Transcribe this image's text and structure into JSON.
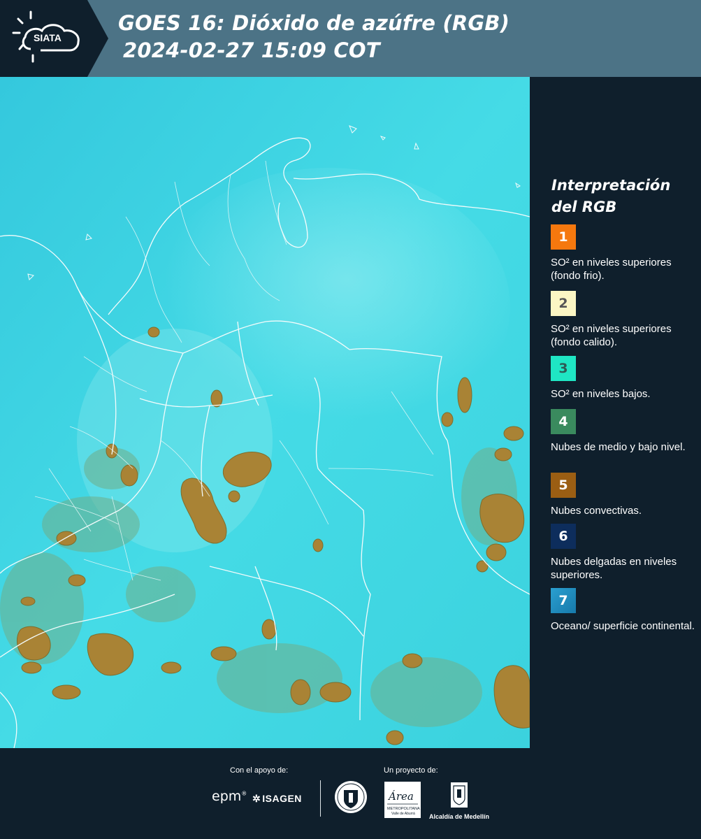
{
  "header": {
    "logo_text": "SIATA",
    "title_line1": "GOES 16: Dióxido de azúfre (RGB)",
    "title_line2": "2024-02-27 15:09 COT"
  },
  "legend": {
    "title": "Interpretación del RGB",
    "items": [
      {
        "number": "1",
        "color": "#f5780e",
        "text_color": "#ffffff",
        "label": "SO² en niveles superiores (fondo frio)."
      },
      {
        "number": "2",
        "color": "#fbf6c4",
        "text_color": "#555555",
        "label": "SO² en niveles superiores (fondo calido)."
      },
      {
        "number": "3",
        "color": "#1fe6c4",
        "text_color": "#2e5a55",
        "label": "SO² en niveles bajos."
      },
      {
        "number": "4",
        "color": "#3a8a5e",
        "text_color": "#ffffff",
        "label": "Nubes de medio y bajo nivel."
      },
      {
        "number": "5",
        "color": "#9b5e13",
        "text_color": "#ffffff",
        "label": "Nubes convectivas."
      },
      {
        "number": "6",
        "color": "#0d2d5c",
        "text_color": "#ffffff",
        "label": "Nubes delgadas en niveles superiores."
      },
      {
        "number": "7",
        "color": "#1b86b8",
        "text_color": "#ffffff",
        "label": "Oceano/ superficie continental."
      }
    ]
  },
  "footer": {
    "support_caption": "Con el apoyo de:",
    "project_caption": "Un proyecto de:",
    "epm_text": "epm",
    "isagen_text": "ISAGEN",
    "metropolitana_text": "Área",
    "metropolitana_sub": "METROPOLITANA",
    "metropolitana_sub2": "Valle de Aburrá",
    "alcaldia_label": "Alcaldía de Medellín"
  },
  "colors": {
    "header_bg": "#4c7386",
    "dark_bg": "#0f1f2c",
    "map_background": "#3ad6e0",
    "convective_clouds": "#9a7a33"
  }
}
